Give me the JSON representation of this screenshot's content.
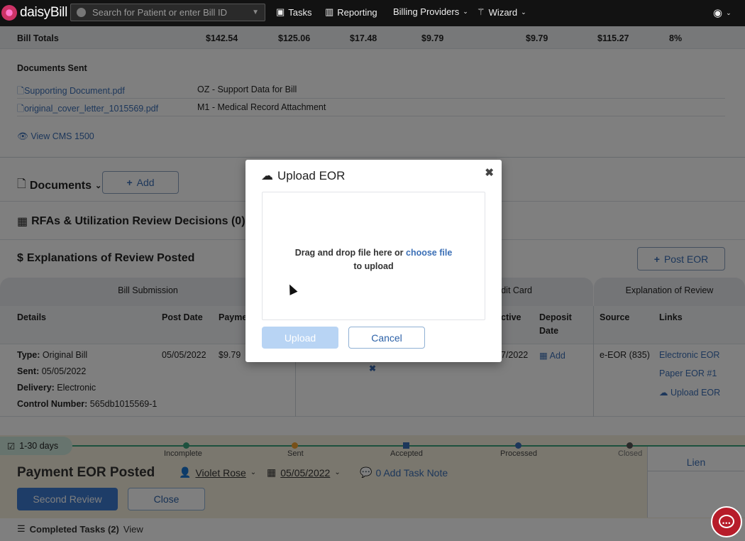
{
  "nav": {
    "brand": "daisyBill",
    "search_placeholder": "Search for Patient or enter Bill ID",
    "tasks": "Tasks",
    "reporting": "Reporting",
    "billing_providers": "Billing Providers",
    "wizard": "Wizard"
  },
  "bill_totals": {
    "label": "Bill Totals",
    "values": [
      "$142.54",
      "$125.06",
      "$17.48",
      "$9.79",
      "$9.79",
      "$115.27",
      "8%"
    ]
  },
  "documents_sent": {
    "heading": "Documents Sent",
    "rows": [
      {
        "file": "Supporting Document.pdf",
        "desc": "OZ - Support Data for Bill"
      },
      {
        "file": "original_cover_letter_1015569.pdf",
        "desc": "M1 - Medical Record Attachment"
      }
    ],
    "view_cms": "View CMS 1500"
  },
  "documents": {
    "title": "Documents",
    "add": "Add"
  },
  "rfas": {
    "title": "RFAs & Utilization Review Decisions (0)"
  },
  "eor": {
    "title": "Explanations of Review Posted",
    "post_button": "Post EOR",
    "groups": {
      "bill_submission": "Bill Submission",
      "credit_card": "dit Card",
      "eor": "Explanation of Review"
    },
    "cols": {
      "details": "Details",
      "post_date": "Post Date",
      "payment": "Payme",
      "effective": "ctive",
      "deposit_date_1": "Deposit",
      "deposit_date_2": "Date",
      "source": "Source",
      "links": "Links"
    },
    "row": {
      "type_label": "Type:",
      "type_value": "Original Bill",
      "sent_label": "Sent:",
      "sent_value": "05/05/2022",
      "delivery_label": "Delivery:",
      "delivery_value": "Electronic",
      "control_label": "Control Number:",
      "control_value": "565db1015569-1",
      "post_date": "05/05/2022",
      "payment": "$9.79",
      "effective": "7/2022",
      "deposit_add": "Add",
      "source": "e-EOR (835)",
      "link1": "Electronic EOR",
      "link2": "Paper EOR #1",
      "link3": "Upload EOR"
    }
  },
  "timeline": {
    "badge": "1-30 days",
    "steps": [
      "Incomplete",
      "Sent",
      "Accepted",
      "Processed",
      "Closed"
    ],
    "lien": "Lien"
  },
  "task": {
    "title": "Payment EOR Posted",
    "assignee": "Violet Rose",
    "date": "05/05/2022",
    "note": "0 Add Task Note",
    "second_review": "Second Review",
    "close": "Close",
    "completed": "Completed Tasks (2)",
    "view": "View"
  },
  "modal": {
    "title": "Upload EOR",
    "drop_text": "Drag and drop file here or",
    "choose": "choose file",
    "drop_text2": "to upload",
    "upload": "Upload",
    "cancel": "Cancel"
  }
}
